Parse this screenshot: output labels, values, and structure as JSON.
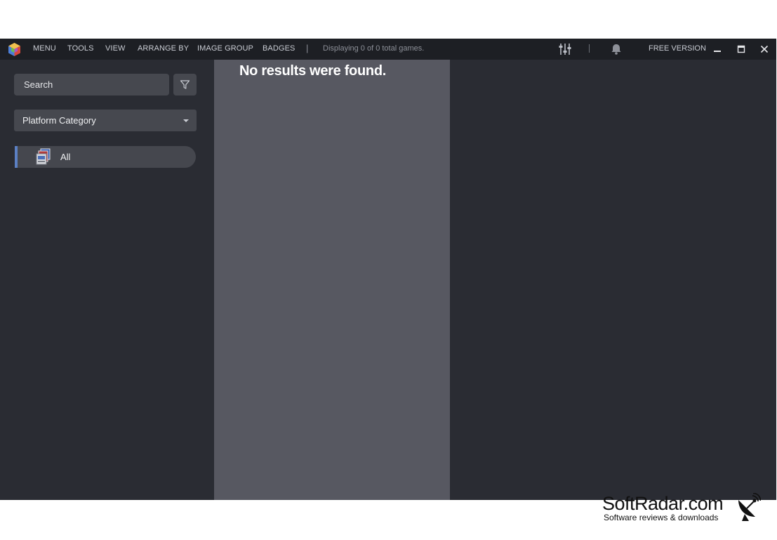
{
  "menu": {
    "items": [
      "MENU",
      "TOOLS",
      "VIEW",
      "ARRANGE BY",
      "IMAGE GROUP",
      "BADGES"
    ],
    "separator": "|",
    "status": "Displaying 0 of 0 total games.",
    "free_version": "FREE VERSION"
  },
  "sidebar": {
    "search_placeholder": "Search",
    "dropdown_selected": "Platform Category",
    "platforms": [
      {
        "label": "All",
        "icon": "game-collection-icon",
        "selected": true
      }
    ]
  },
  "results": {
    "message": "No results were found."
  },
  "watermark": {
    "title": "SoftRadar.com",
    "subtitle": "Software reviews & downloads"
  },
  "colors": {
    "titlebar": "#1d1f24",
    "sidebar": "#2a2c33",
    "results_bg": "#575861",
    "accent": "#5b80c4"
  }
}
